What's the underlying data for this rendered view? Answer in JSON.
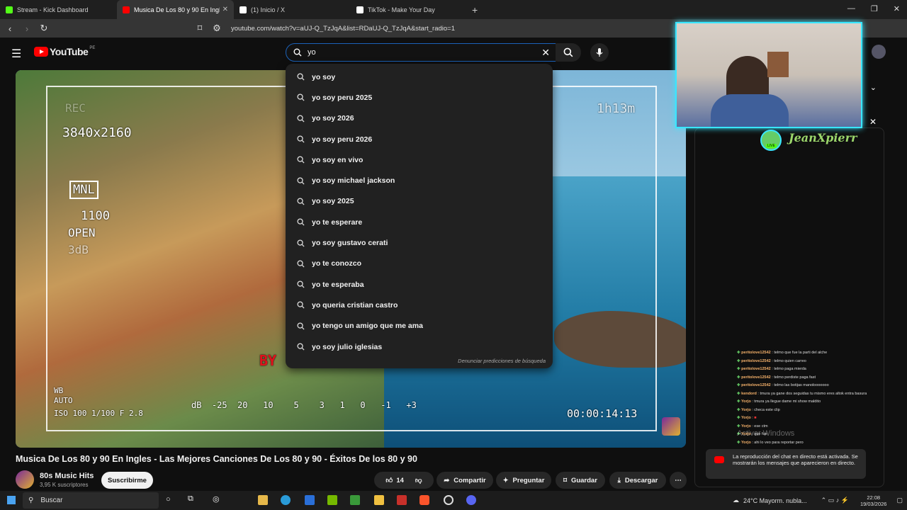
{
  "browser": {
    "tabs": [
      {
        "title": "Stream - Kick Dashboard",
        "color": "#53fc18"
      },
      {
        "title": "Musica De Los 80 y 90 En Ingles",
        "color": "#ff0000"
      },
      {
        "title": "(1) Inicio / X",
        "color": "#ffffff"
      },
      {
        "title": "TikTok - Make Your Day",
        "color": "#ffffff"
      }
    ],
    "url": "youtube.com/watch?v=aUJ-Q_TzJqA&list=RDaUJ-Q_TzJqA&start_radio=1"
  },
  "youtube": {
    "logo_text": "YouTube",
    "country": "PE",
    "search_value": "yo",
    "suggestions": [
      "yo soy",
      "yo soy peru 2025",
      "yo soy 2026",
      "yo soy peru 2026",
      "yo soy en vivo",
      "yo soy michael jackson",
      "yo soy 2025",
      "yo te esperare",
      "yo soy gustavo cerati",
      "yo te conozco",
      "yo te esperaba",
      "yo queria cristian castro",
      "yo tengo un amigo que me ama",
      "yo soy julio iglesias"
    ],
    "report_label": "Denunciar predicciones de búsqueda"
  },
  "video": {
    "hud": {
      "rec": "REC",
      "resolution": "3840x2160",
      "mode": "MNL",
      "iso_line": "1100",
      "open": "OPEN",
      "db": "3dB",
      "time_left": "1h13m",
      "wb": "WB",
      "auto": "AUTO",
      "exposure": "ISO 100 1/100 F 2.8",
      "meter": "dB  -25  20   10    5    3   1   0   -1   +3",
      "timecode": "00:00:14:13",
      "by": "BY"
    },
    "title": "Musica De Los 80 y 90 En Ingles - Las Mejores Canciones De Los 80 y 90 - Éxitos De los 80 y 90",
    "channel": "80s Music Hits",
    "subscribers": "3,95 K suscriptores",
    "subscribe_label": "Suscribirme",
    "likes": "14",
    "share_label": "Compartir",
    "ask_label": "Preguntar",
    "save_label": "Guardar",
    "download_label": "Descargar"
  },
  "stream": {
    "streamer": "JeanXpierr",
    "live": "LIVE",
    "chat": [
      {
        "user": "peritolove12542",
        "msg": "telmo que fue la parti del alche"
      },
      {
        "user": "peritolove12542",
        "msg": "telmo quien carreo"
      },
      {
        "user": "peritolove12542",
        "msg": "telmo paga mierda"
      },
      {
        "user": "peritolove12542",
        "msg": "telmo perdiste paga fast"
      },
      {
        "user": "peritolove12542",
        "msg": "telmo las botijas manolooooooo"
      },
      {
        "user": "kendord",
        "msg": "tmura ya gane dos seguidas tu mismo eres altok entra basura"
      },
      {
        "user": "Yorjo",
        "msg": "tmura ya llegue dame mi show maldito"
      },
      {
        "user": "Yorjo",
        "msg": "checa este clip"
      },
      {
        "user": "Yorjo",
        "msg": ""
      },
      {
        "user": "Yorjo",
        "msg": "ese ctm"
      },
      {
        "user": "Yorjo",
        "msg": "que fue"
      },
      {
        "user": "Yorjo",
        "msg": "ahi lo veo para reportar pero"
      }
    ],
    "notice": "La reproducción del chat en directo está activada. Se mostrarán los mensajes que aparecieron en directo.",
    "watermark": "Activar Windows"
  },
  "taskbar": {
    "search": "Buscar",
    "weather": "24°C  Mayorm. nubla...",
    "time": "22:08",
    "date": "19/03/2026"
  }
}
